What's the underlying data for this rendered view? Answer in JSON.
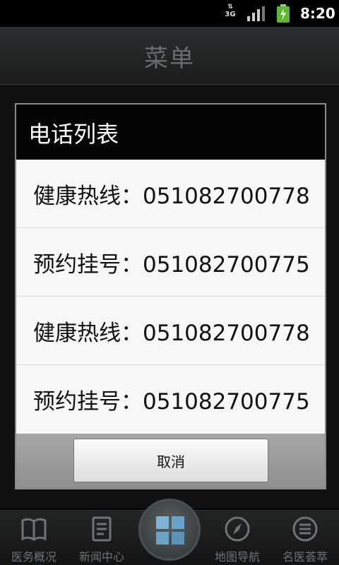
{
  "status_bar": {
    "network": "3G",
    "time": "8:20",
    "icons": [
      "network-3g-icon",
      "signal-icon",
      "battery-charging-icon"
    ]
  },
  "header": {
    "title": "菜单"
  },
  "dialog": {
    "title": "电话列表",
    "items": [
      {
        "label": "健康热线：051082700778"
      },
      {
        "label": "预约挂号：051082700775"
      },
      {
        "label": "健康热线：051082700778"
      },
      {
        "label": "预约挂号：051082700775"
      }
    ],
    "cancel_label": "取消"
  },
  "bottom_nav": {
    "items": [
      {
        "label": "医务概况",
        "icon": "book-icon"
      },
      {
        "label": "新闻中心",
        "icon": "document-icon"
      },
      {
        "label": "",
        "icon": "grid-icon"
      },
      {
        "label": "地图导航",
        "icon": "compass-icon"
      },
      {
        "label": "名医荟萃",
        "icon": "list-icon"
      }
    ]
  },
  "colors": {
    "dialog_header": "#050505",
    "list_bg": "#f7f7f7",
    "footer_bg": "#9b9b9b",
    "nav_text": "#6f7376"
  }
}
